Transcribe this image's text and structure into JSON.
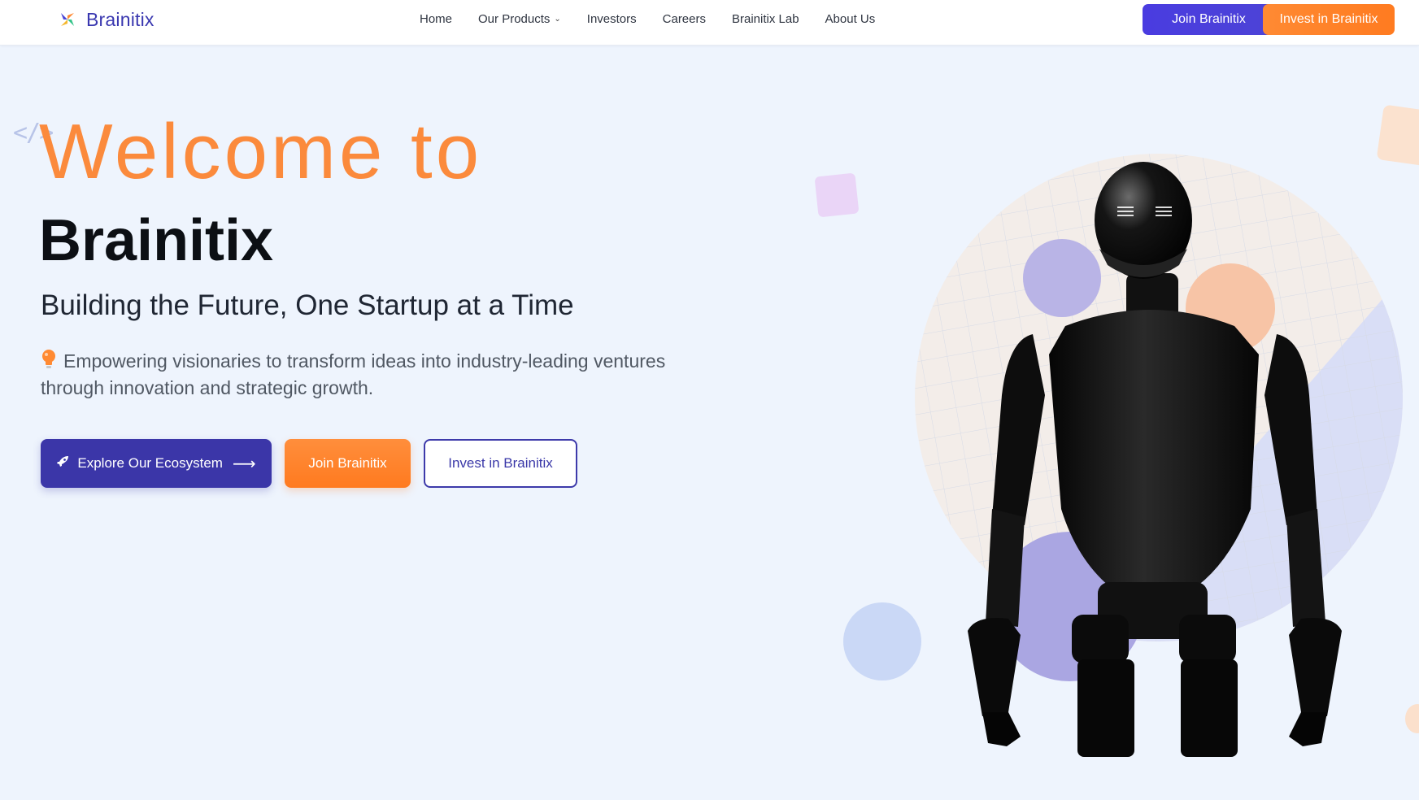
{
  "nav": {
    "logo_text": "Brainitix",
    "links": [
      {
        "label": "Home"
      },
      {
        "label": "Our Products",
        "has_dropdown": true
      },
      {
        "label": "Investors"
      },
      {
        "label": "Careers"
      },
      {
        "label": "Brainitix Lab"
      },
      {
        "label": "About Us"
      }
    ],
    "join_label": "Join Brainitix",
    "invest_label": "Invest in Brainitix"
  },
  "hero": {
    "code_mark": "</>",
    "welcome": "Welcome to",
    "brand": "Brainitix",
    "tagline": "Building the Future, One Startup at a Time",
    "description": "Empowering visionaries to transform ideas into industry-leading ventures through innovation and strategic growth.",
    "buttons": {
      "explore": "Explore Our Ecosystem",
      "join": "Join Brainitix",
      "invest": "Invest in Brainitix"
    }
  },
  "colors": {
    "primary": "#3b36a8",
    "accent": "#fb8a3c",
    "background": "#eef4fd"
  },
  "icons": {
    "logo": "brainitix-logo-icon",
    "dropdown": "chevron-down-icon",
    "bulb": "lightbulb-icon",
    "rocket": "rocket-icon",
    "arrow": "arrow-right-icon"
  }
}
